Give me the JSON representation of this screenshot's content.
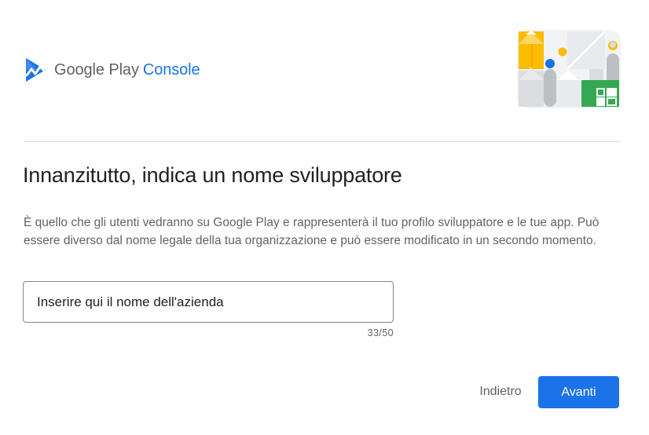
{
  "brand": {
    "name": "Google Play",
    "product": "Console",
    "accent_color": "#1a73e8",
    "logo_icon": "google-play-console-logo-icon"
  },
  "hero": {
    "illustration": "developer-illustration"
  },
  "main": {
    "title": "Innanzitutto, indica un nome sviluppatore",
    "description": "È quello che gli utenti vedranno su Google Play e rappresenterà il tuo profilo sviluppatore e le tue app. Può essere diverso dal nome legale della tua organizzazione e può essere modificato in un secondo momento.",
    "developer_name": {
      "value": "Inserire qui il nome dell'azienda",
      "counter": "33/50"
    }
  },
  "actions": {
    "back_label": "Indietro",
    "next_label": "Avanti"
  }
}
